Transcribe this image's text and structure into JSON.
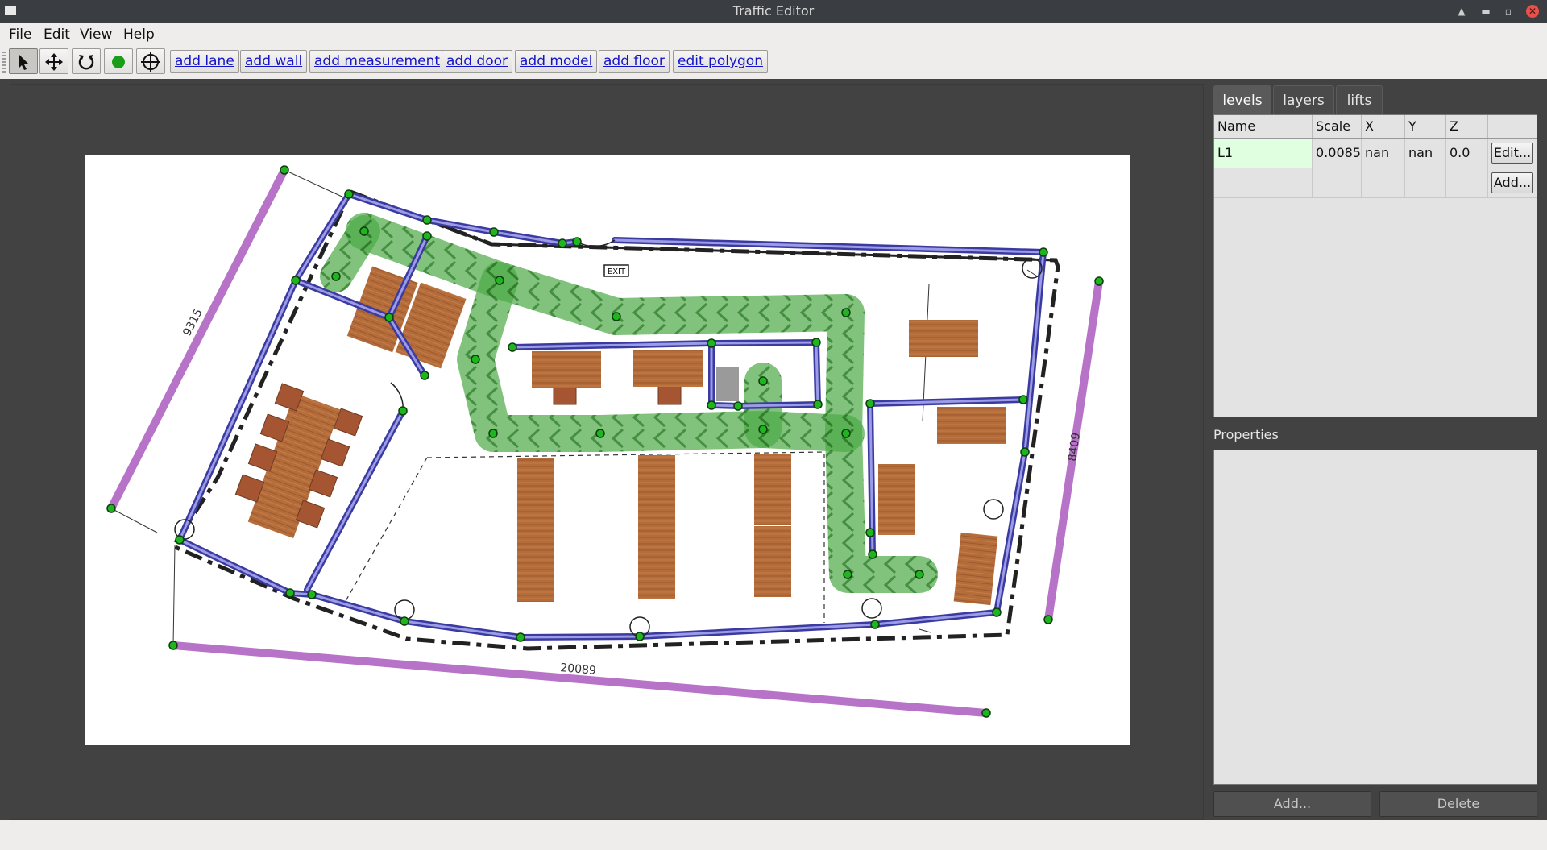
{
  "window": {
    "title": "Traffic Editor"
  },
  "menu": {
    "file": "File",
    "edit": "Edit",
    "view": "View",
    "help": "Help"
  },
  "toolbar": {
    "tools": [
      "select-tool",
      "move-tool",
      "rotate-tool",
      "add-vertex-tool",
      "crosshair-tool"
    ],
    "buttons": {
      "add_lane": "add lane",
      "add_wall": "add wall",
      "add_measurement": "add measurement",
      "add_door": "add door",
      "add_model": "add model",
      "add_floor": "add floor",
      "edit_polygon": "edit polygon"
    }
  },
  "canvas": {
    "dimensions": {
      "left": "9315",
      "bottom": "20089",
      "right": "8409"
    },
    "exit_label": "EXIT"
  },
  "tabs": {
    "levels": "levels",
    "layers": "layers",
    "lifts": "lifts",
    "selected": "levels"
  },
  "levels_table": {
    "headers": {
      "name": "Name",
      "scale": "Scale",
      "x": "X",
      "y": "Y",
      "z": "Z"
    },
    "rows": [
      {
        "name": "L1",
        "scale": "0.0085",
        "x": "nan",
        "y": "nan",
        "z": "0.0",
        "action": "Edit..."
      }
    ],
    "add_row_button": "Add..."
  },
  "properties": {
    "title": "Properties",
    "add_button": "Add...",
    "delete_button": "Delete"
  },
  "colors": {
    "lane_green": "#4caa44",
    "wall_blue": "#5b5bc8",
    "measurement_purple": "#b773c8",
    "vertex_green": "#1fb51f",
    "furniture_brown": "#b06a3a"
  }
}
